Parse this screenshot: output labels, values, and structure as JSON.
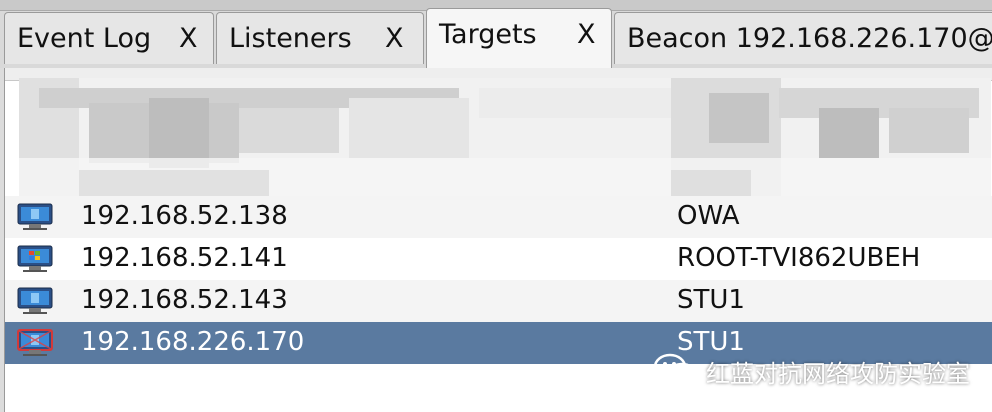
{
  "tabs": [
    {
      "label": "Event Log",
      "close": "X",
      "active": false
    },
    {
      "label": "Listeners",
      "close": "X",
      "active": false
    },
    {
      "label": "Targets",
      "close": "X",
      "active": true
    },
    {
      "label": "Beacon 192.168.226.170@",
      "close": "",
      "active": false
    }
  ],
  "targets": {
    "rows": [
      {
        "address": "192.168.52.138",
        "name": "OWA",
        "icon": "windows-server-icon",
        "selected": false
      },
      {
        "address": "192.168.52.141",
        "name": "ROOT-TVI862UBEH",
        "icon": "windows-xp-icon",
        "selected": false
      },
      {
        "address": "192.168.52.143",
        "name": "STU1",
        "icon": "windows-server-icon",
        "selected": false
      },
      {
        "address": "192.168.226.170",
        "name": "STU1",
        "icon": "windows-server-beacon-icon",
        "selected": true
      }
    ]
  },
  "watermark": {
    "text": "红蓝对抗网络攻防实验室"
  },
  "colors": {
    "selected_row": "#5a7aa0",
    "row_alt": "#f4f4f4",
    "tab_active": "#f6f6f6"
  }
}
